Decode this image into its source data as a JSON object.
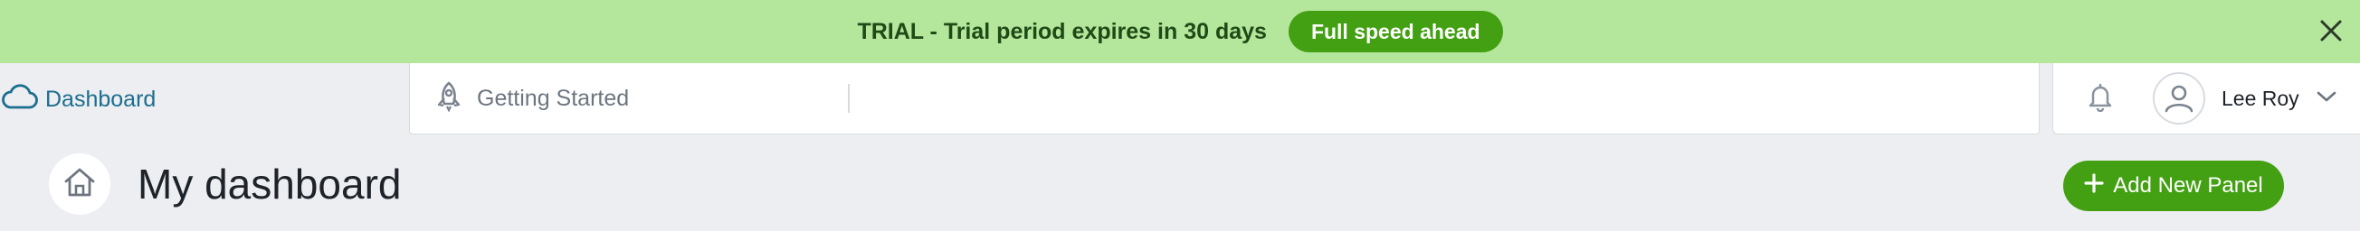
{
  "banner": {
    "text": "TRIAL - Trial period expires in ",
    "days": "30 days",
    "cta_label": "Full speed ahead",
    "close_icon": "close-icon",
    "background": "#b4e69c"
  },
  "nav": {
    "dashboard_label": "Dashboard",
    "dashboard_icon": "cloud-icon",
    "getting_started_label": "Getting Started",
    "getting_started_icon": "rocket-icon",
    "notifications_icon": "bell-icon",
    "user_name": "Lee Roy",
    "user_icon": "user-avatar-icon",
    "menu_icon": "chevron-down-icon"
  },
  "page": {
    "home_icon": "home-icon",
    "title": "My dashboard",
    "add_panel_label": "Add New Panel",
    "add_icon": "plus-icon"
  },
  "colors": {
    "accent_green": "#43a012",
    "link_blue": "#1c6e8e",
    "page_bg": "#eceef1"
  }
}
